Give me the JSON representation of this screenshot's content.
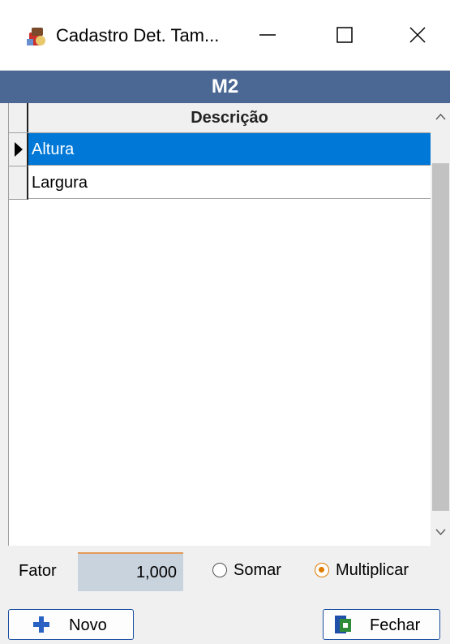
{
  "window": {
    "title": "Cadastro Det. Tam...",
    "controls": {
      "minimize": "minimize",
      "maximize": "maximize",
      "close": "close"
    }
  },
  "header": {
    "title": "M2"
  },
  "grid": {
    "column_header": "Descrição",
    "rows": [
      {
        "label": "Altura",
        "selected": true
      },
      {
        "label": "Largura",
        "selected": false
      }
    ]
  },
  "fator": {
    "label": "Fator",
    "value": "1,000"
  },
  "operation": {
    "options": [
      {
        "label": "Somar",
        "checked": false
      },
      {
        "label": "Multiplicar",
        "checked": true
      }
    ]
  },
  "buttons": {
    "novo": "Novo",
    "fechar": "Fechar"
  },
  "colors": {
    "header_band": "#4b6894",
    "selection": "#0078d7",
    "radio_accent": "#e07b00",
    "button_border": "#1a4fa0"
  }
}
